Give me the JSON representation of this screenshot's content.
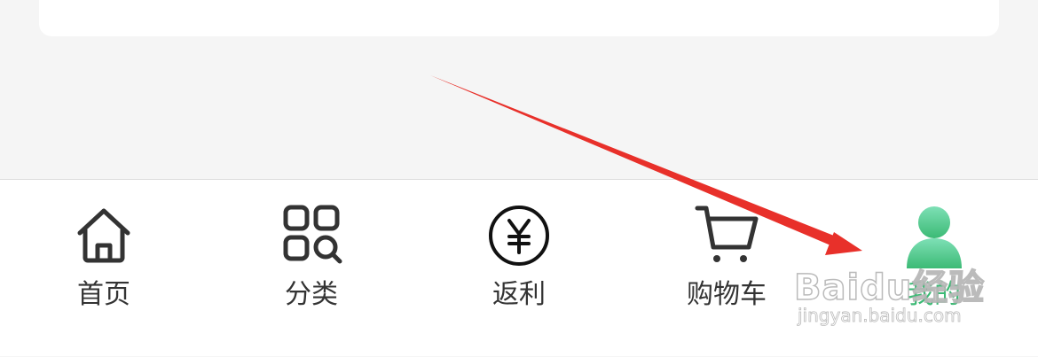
{
  "tabbar": {
    "items": [
      {
        "label": "首页",
        "icon": "home-icon"
      },
      {
        "label": "分类",
        "icon": "category-icon"
      },
      {
        "label": "返利",
        "icon": "yen-icon"
      },
      {
        "label": "购物车",
        "icon": "cart-icon"
      },
      {
        "label": "我的",
        "icon": "user-icon",
        "active": true
      }
    ],
    "active_color": "#3cba75",
    "text_color": "#333333"
  },
  "watermark": {
    "brand": "Baidu经验",
    "url": "jingyan.baidu.com"
  },
  "annotation": {
    "arrow_color": "#e8302a"
  }
}
